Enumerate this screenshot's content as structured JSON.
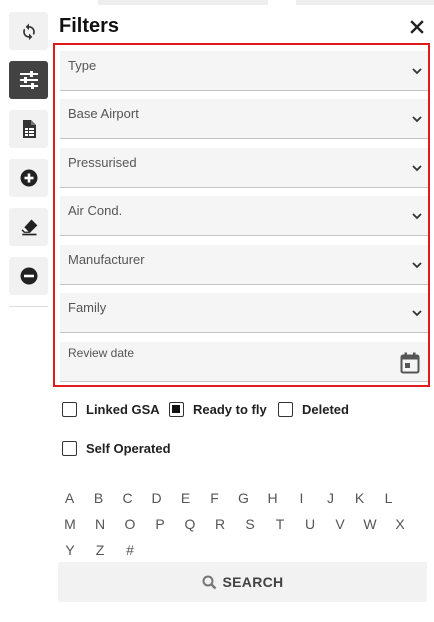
{
  "panel": {
    "title": "Filters",
    "close_glyph": "×"
  },
  "toolbar": {
    "items": [
      {
        "icon": "refresh-icon",
        "active": false
      },
      {
        "icon": "sliders-icon",
        "active": true
      },
      {
        "icon": "spreadsheet-icon",
        "active": false
      },
      {
        "icon": "add-circle-icon",
        "active": false
      },
      {
        "icon": "eraser-icon",
        "active": false
      },
      {
        "icon": "remove-circle-icon",
        "active": false
      }
    ]
  },
  "filters": {
    "type": {
      "label": "Type"
    },
    "base_airport": {
      "label": "Base Airport"
    },
    "pressurised": {
      "label": "Pressurised"
    },
    "air_cond": {
      "label": "Air Cond."
    },
    "manufacturer": {
      "label": "Manufacturer"
    },
    "family": {
      "label": "Family"
    },
    "review_date": {
      "label": "Review date"
    }
  },
  "checkboxes": {
    "linked_gsa": {
      "label": "Linked GSA",
      "checked": false
    },
    "ready_to_fly": {
      "label": "Ready to fly",
      "checked": true
    },
    "deleted": {
      "label": "Deleted",
      "checked": false
    },
    "self_operated": {
      "label": "Self Operated",
      "checked": false
    }
  },
  "alphabet": {
    "row1": [
      "A",
      "B",
      "C",
      "D",
      "E",
      "F",
      "G",
      "H",
      "I",
      "J",
      "K",
      "L"
    ],
    "row2": [
      "M",
      "N",
      "O",
      "P",
      "Q",
      "R",
      "S",
      "T",
      "U",
      "V",
      "W",
      "X"
    ],
    "row3": [
      "Y",
      "Z",
      "#"
    ]
  },
  "search": {
    "label": "SEARCH"
  }
}
